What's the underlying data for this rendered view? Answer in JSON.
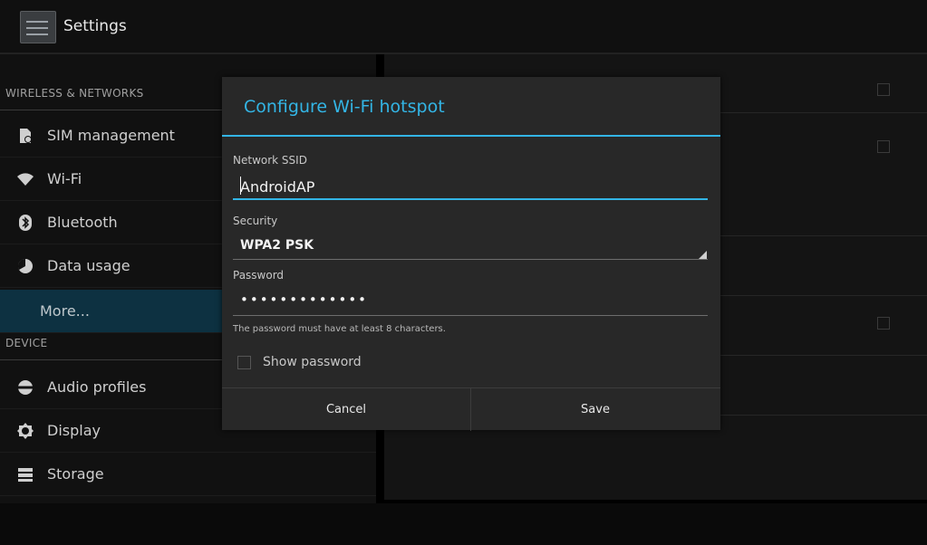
{
  "app": {
    "title": "Settings",
    "icon": "settings-icon"
  },
  "sidebar": {
    "wireless_header": "WIRELESS & NETWORKS",
    "device_header": "DEVICE",
    "items": [
      {
        "label": "SIM management",
        "icon": "sim-card-icon"
      },
      {
        "label": "Wi-Fi",
        "icon": "wifi-icon"
      },
      {
        "label": "Bluetooth",
        "icon": "bluetooth-icon"
      },
      {
        "label": "Data usage",
        "icon": "data-usage-icon"
      },
      {
        "label": "More...",
        "icon": "",
        "selected": true
      },
      {
        "label": "Audio profiles",
        "icon": "audio-profiles-icon"
      },
      {
        "label": "Display",
        "icon": "display-icon"
      },
      {
        "label": "Storage",
        "icon": "storage-icon"
      }
    ]
  },
  "dialog": {
    "title": "Configure Wi-Fi hotspot",
    "ssid_label": "Network SSID",
    "ssid_value": "AndroidAP",
    "security_label": "Security",
    "security_value": "WPA2 PSK",
    "password_label": "Password",
    "password_value": "•••••••••••••",
    "password_hint": "The password must have at least 8 characters.",
    "show_password_label": "Show password",
    "show_password_checked": false,
    "cancel_label": "Cancel",
    "save_label": "Save"
  },
  "colors": {
    "accent": "#33b5e5",
    "selected_bg": "#0d3141",
    "dialog_bg": "#282828"
  }
}
